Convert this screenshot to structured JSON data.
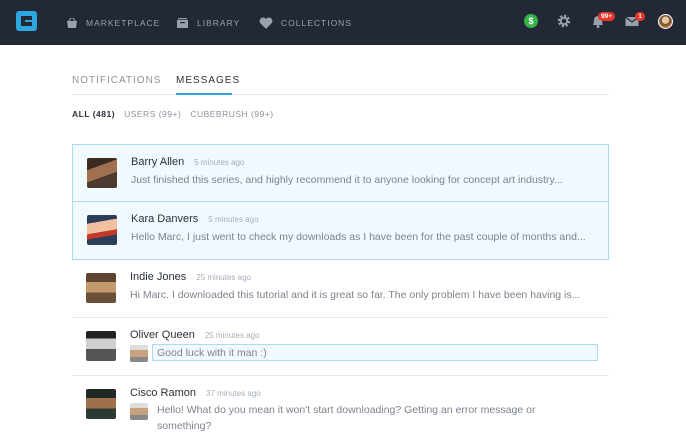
{
  "topbar": {
    "nav": [
      {
        "label": "MARKETPLACE",
        "icon": "basket-icon"
      },
      {
        "label": "LIBRARY",
        "icon": "library-icon"
      },
      {
        "label": "COLLECTIONS",
        "icon": "heart-icon"
      }
    ],
    "coin_symbol": "$",
    "notifications_badge": "99+",
    "mail_badge": "1"
  },
  "tabs": [
    "NOTIFICATIONS",
    "MESSAGES"
  ],
  "active_tab": "MESSAGES",
  "filters": [
    {
      "label": "ALL (481)",
      "active": true
    },
    {
      "label": "USERS (99+)",
      "active": false
    },
    {
      "label": "CUBEBRUSH (99+)",
      "active": false
    }
  ],
  "messages": [
    {
      "name": "Barry Allen",
      "time": "5 minutes ago",
      "text": "Just finished this series, and highly recommend it to anyone looking for concept art industry...",
      "unread": true
    },
    {
      "name": "Kara Danvers",
      "time": "5 minutes ago",
      "text": "Hello Marc, I just went to check my downloads as I have been for the past couple of months and...",
      "unread": true
    },
    {
      "name": "Indie Jones",
      "time": "25 minutes ago",
      "text": "Hi Marc. I downloaded this tutorial and it is great so far. The only problem I have been having is...",
      "unread": false
    },
    {
      "name": "Oliver Queen",
      "time": "25 minutes ago",
      "text": "Good luck with it man :)",
      "unread": false,
      "reply": true
    },
    {
      "name": "Cisco Ramon",
      "time": "37 minutes ago",
      "text": "Hello! What do you mean it won't start downloading? Getting an error message or something?",
      "unread": false,
      "reply": true
    }
  ],
  "colors": {
    "topbar": "#232836",
    "accent": "#2ba6de",
    "unread_bg": "#f0f9fd",
    "badge": "#e8352b",
    "coin": "#38b24a"
  }
}
